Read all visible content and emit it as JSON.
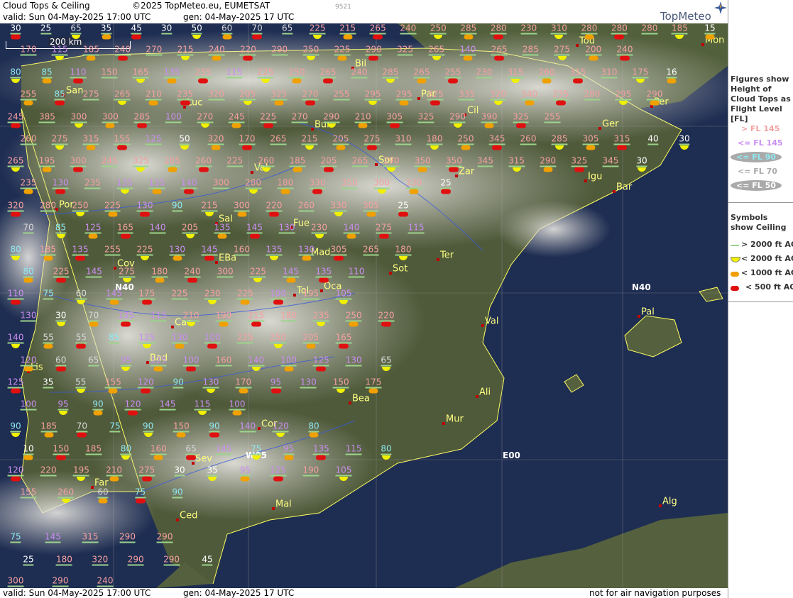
{
  "header": {
    "title": "Cloud Tops & Ceiling",
    "copyright": "©2025 TopMeteo.eu, EUMETSAT",
    "valid": "valid:  Sun  04-May-2025  17:00 UTC",
    "generated": "gen: 04-May-2025 17 UTC",
    "id": "9521",
    "logo": "TopMeteo"
  },
  "footer": {
    "valid": "valid:  Sun  04-May-2025  17:00 UTC",
    "generated": "gen: 04-May-2025 17 UTC",
    "disclaimer": "not for air navigation purposes"
  },
  "scale_label": "200 km",
  "grid_labels": [
    "N40",
    "N40",
    "W05",
    "E00"
  ],
  "legend": {
    "fig_title": "Figures show Height of Cloud Tops as Flight Level  [FL]",
    "fig_items": [
      {
        "text": "> FL 145",
        "color": "#f4a0a0"
      },
      {
        "text": "<= FL 145",
        "color": "#c98ef0"
      },
      {
        "text": "<= FL 90",
        "color": "#8ee8f0"
      },
      {
        "text": "<= FL 70",
        "color": "#d8d8d8"
      },
      {
        "text": "<= FL 50",
        "color": "#ffffff"
      }
    ],
    "sym_title": "Symbols show Ceiling",
    "sym_items": [
      {
        "text": "> 2000 ft AGL",
        "icon": "green-line"
      },
      {
        "text": "< 2000 ft AGL",
        "icon": "yellow-half-circle"
      },
      {
        "text": "< 1000 ft AGL",
        "icon": "orange-oval"
      },
      {
        "text": "< 500 ft AGL",
        "icon": "red-oval"
      }
    ]
  },
  "cities": [
    "Bil",
    "San",
    "Luc",
    "Par",
    "Cil",
    "Tou",
    "Mon",
    "Per",
    "Ger",
    "Bur",
    "Val",
    "Sor",
    "Zar",
    "Igu",
    "Bar",
    "Por",
    "Sal",
    "Fue",
    "Mad",
    "Ter",
    "Cov",
    "EBa",
    "Sot",
    "Oca",
    "Tol",
    "Cac",
    "Val",
    "Pal",
    "Bad",
    "Lis",
    "Bea",
    "Ali",
    "Mur",
    "Cor",
    "Sev",
    "Far",
    "Mal",
    "Ced",
    "Alg"
  ],
  "values": [
    [
      "30",
      "25",
      "65",
      "35",
      "45",
      "30",
      "50",
      "60",
      "70",
      "65",
      "225",
      "215",
      "265",
      "240",
      "250",
      "285",
      "280",
      "230",
      "310",
      "280",
      "280",
      "280",
      "185",
      "15"
    ],
    [
      "170",
      "115",
      "185",
      "240",
      "270",
      "215",
      "240",
      "220",
      "290",
      "250",
      "225",
      "290",
      "325",
      "265",
      "140",
      "265",
      "285",
      "275",
      "200",
      "240"
    ],
    [
      "80",
      "85",
      "110",
      "150",
      "165",
      "135",
      "235",
      "115",
      "225",
      "250",
      "265",
      "240",
      "285",
      "265",
      "255",
      "230",
      "315",
      "260",
      "315",
      "310",
      "175",
      "16"
    ],
    [
      "255",
      "85",
      "275",
      "265",
      "210",
      "235",
      "320",
      "205",
      "325",
      "270",
      "255",
      "295",
      "295",
      "325",
      "335",
      "320",
      "340",
      "235",
      "280",
      "295",
      "290"
    ],
    [
      "245",
      "385",
      "300",
      "300",
      "285",
      "100",
      "270",
      "245",
      "225",
      "270",
      "290",
      "210",
      "305",
      "325",
      "290",
      "390",
      "325",
      "255"
    ],
    [
      "260",
      "275",
      "315",
      "155",
      "125",
      "50",
      "320",
      "170",
      "265",
      "215",
      "205",
      "275",
      "310",
      "180",
      "250",
      "345",
      "260",
      "285",
      "305",
      "315",
      "40",
      "30"
    ],
    [
      "265",
      "195",
      "300",
      "245",
      "325",
      "205",
      "260",
      "225",
      "260",
      "185",
      "205",
      "265",
      "290",
      "350",
      "350",
      "345",
      "315",
      "290",
      "325",
      "345",
      "30"
    ],
    [
      "235",
      "130",
      "235",
      "135",
      "135",
      "140",
      "300",
      "280",
      "180",
      "330",
      "350",
      "300",
      "330",
      "25"
    ],
    [
      "320",
      "280",
      "250",
      "225",
      "130",
      "90",
      "215",
      "300",
      "220",
      "260",
      "330",
      "305",
      "25"
    ],
    [
      "70",
      "85",
      "125",
      "165",
      "140",
      "205",
      "135",
      "145",
      "130",
      "230",
      "140",
      "275",
      "115"
    ],
    [
      "80",
      "185",
      "135",
      "255",
      "225",
      "130",
      "145",
      "160",
      "135",
      "130",
      "305",
      "265",
      "180"
    ],
    [
      "80",
      "225",
      "145",
      "275",
      "180",
      "240",
      "300",
      "225",
      "145",
      "135",
      "110"
    ],
    [
      "110",
      "75",
      "60",
      "145",
      "175",
      "225",
      "230",
      "225",
      "100",
      "195",
      "105"
    ],
    [
      "130",
      "30",
      "70",
      "135",
      "115",
      "210",
      "190",
      "215",
      "180",
      "235",
      "250",
      "220"
    ],
    [
      "140",
      "55",
      "55",
      "85",
      "125",
      "130",
      "100",
      "225",
      "250",
      "205",
      "165"
    ],
    [
      "120",
      "60",
      "65",
      "95",
      "125",
      "100",
      "160",
      "140",
      "100",
      "125",
      "130",
      "65"
    ],
    [
      "125",
      "35",
      "55",
      "155",
      "120",
      "90",
      "130",
      "170",
      "95",
      "130",
      "150",
      "175"
    ],
    [
      "100",
      "95",
      "90",
      "120",
      "145",
      "115",
      "100"
    ],
    [
      "90",
      "185",
      "70",
      "75",
      "90",
      "150",
      "90",
      "140",
      "120",
      "80"
    ],
    [
      "10",
      "150",
      "185",
      "80",
      "160",
      "65",
      "145",
      "75",
      "95",
      "135",
      "115",
      "80"
    ],
    [
      "120",
      "220",
      "195",
      "210",
      "275",
      "30",
      "35",
      "95",
      "125",
      "190",
      "105"
    ],
    [
      "155",
      "260",
      "60",
      "75",
      "90"
    ],
    [
      "75",
      "145",
      "315",
      "290",
      "290"
    ],
    [
      "25",
      "180",
      "320",
      "290",
      "290",
      "45"
    ],
    [
      "300",
      "290",
      "240"
    ]
  ]
}
